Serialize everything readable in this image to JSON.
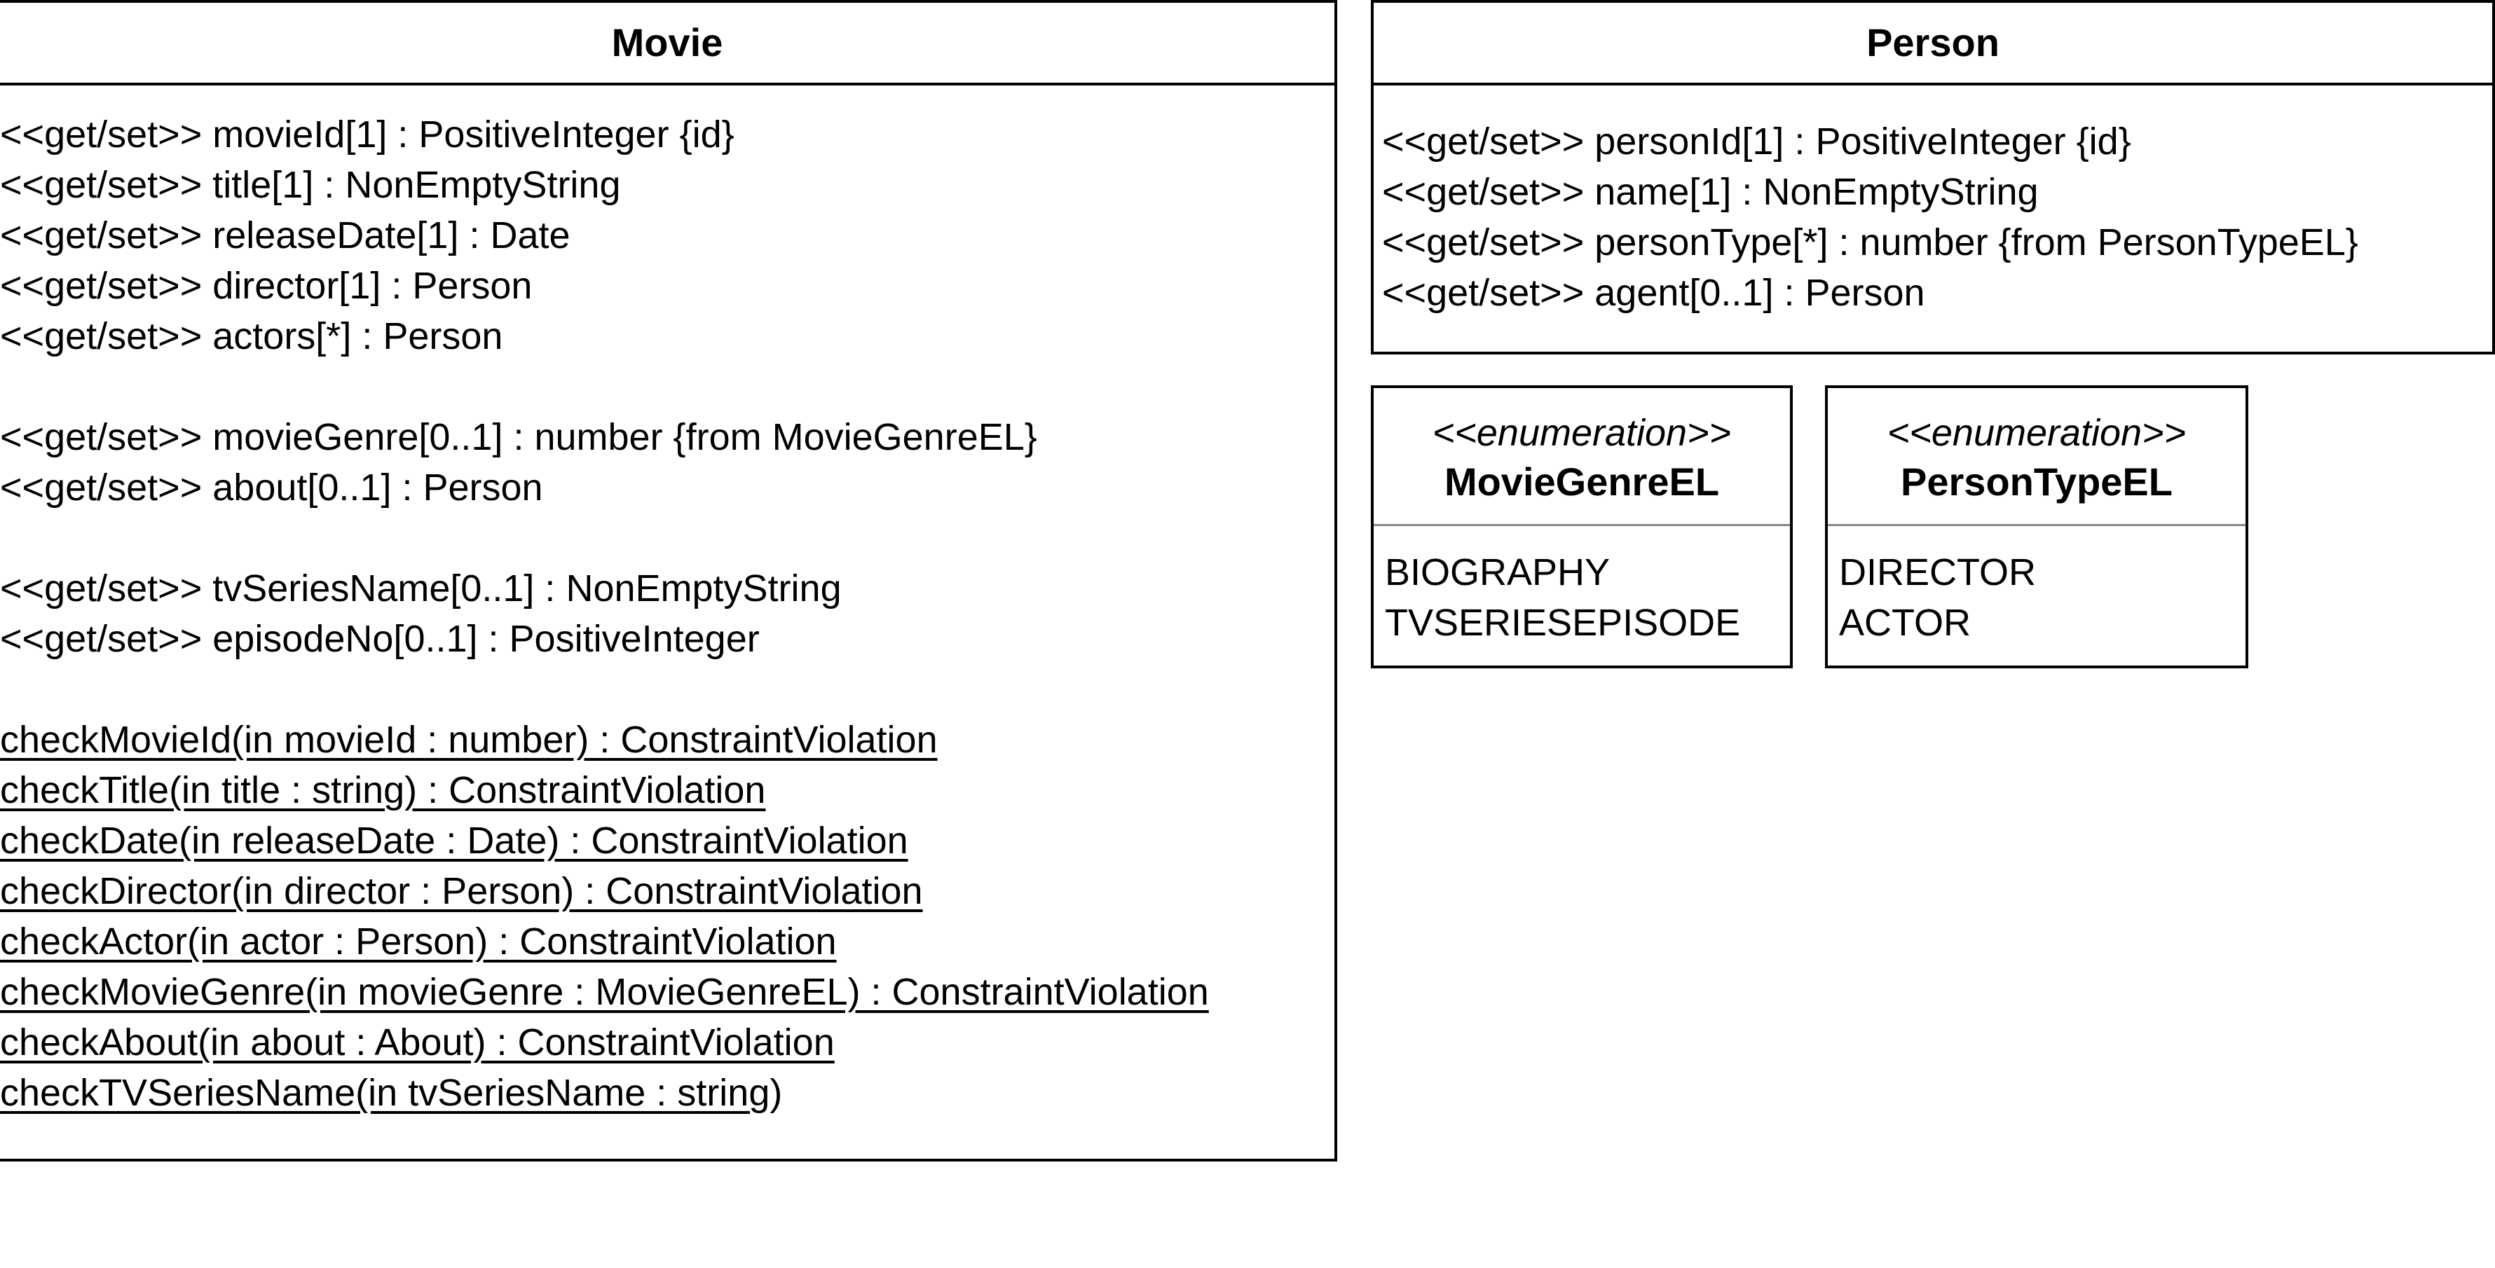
{
  "movie": {
    "name": "Movie",
    "attributes_group1": [
      "<<get/set>> movieId[1] : PositiveInteger {id}",
      "<<get/set>> title[1] : NonEmptyString",
      "<<get/set>> releaseDate[1] : Date",
      "<<get/set>> director[1] : Person",
      "<<get/set>> actors[*] : Person"
    ],
    "attributes_group2": [
      "<<get/set>> movieGenre[0..1] : number {from MovieGenreEL}",
      "<<get/set>> about[0..1] : Person"
    ],
    "attributes_group3": [
      "<<get/set>> tvSeriesName[0..1] : NonEmptyString",
      "<<get/set>> episodeNo[0..1] : PositiveInteger"
    ],
    "operations": [
      "checkMovieId(in movieId : number) : ConstraintViolation",
      "checkTitle(in title : string) : ConstraintViolation",
      "checkDate(in releaseDate : Date) : ConstraintViolation",
      "checkDirector(in director : Person) : ConstraintViolation",
      "checkActor(in actor : Person) : ConstraintViolation",
      "checkMovieGenre(in movieGenre : MovieGenreEL) : ConstraintViolation",
      "checkAbout(in about : About) : ConstraintViolation"
    ],
    "last_operation_underlined": "checkTVSeriesName(in tvSeriesName : string",
    "last_operation_tail": ")"
  },
  "person": {
    "name": "Person",
    "attributes": [
      "<<get/set>> personId[1] : PositiveInteger {id}",
      "<<get/set>> name[1] : NonEmptyString",
      "<<get/set>> personType[*] : number {from PersonTypeEL}",
      "<<get/set>> agent[0..1] : Person"
    ]
  },
  "movie_genre_el": {
    "stereotype": "<<enumeration>>",
    "name": "MovieGenreEL",
    "literals": [
      "BIOGRAPHY",
      "TVSERIESEPISODE"
    ]
  },
  "person_type_el": {
    "stereotype": "<<enumeration>>",
    "name": "PersonTypeEL",
    "literals": [
      "DIRECTOR",
      "ACTOR"
    ]
  }
}
